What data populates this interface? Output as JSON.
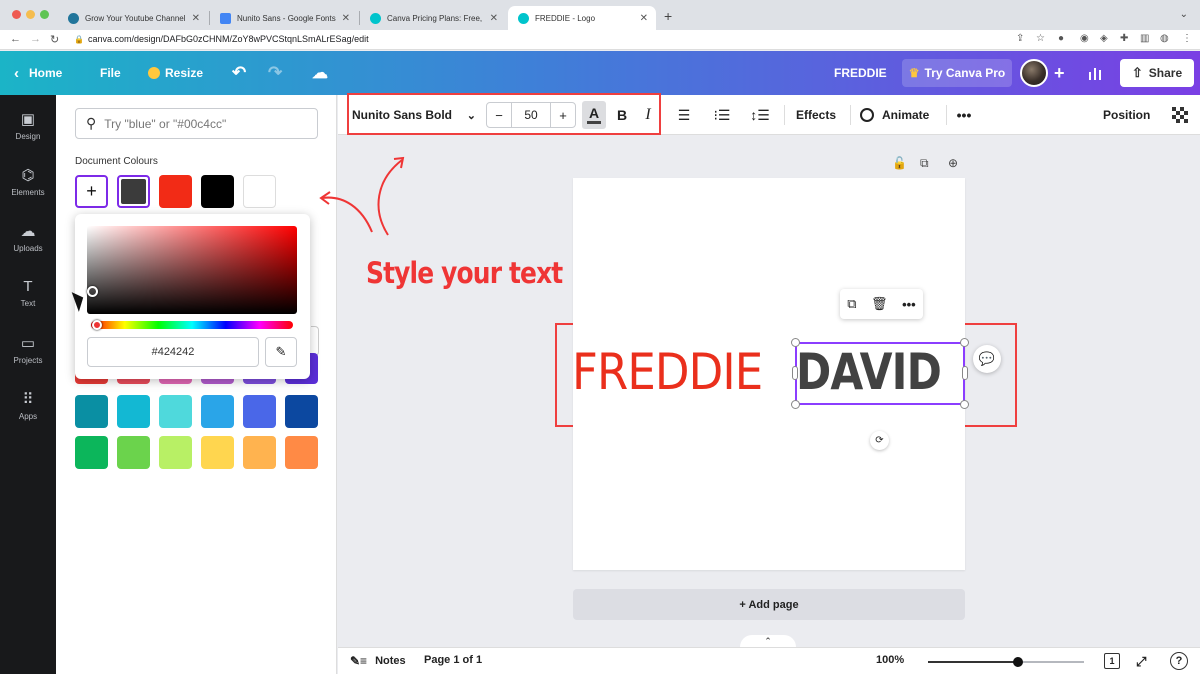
{
  "browser": {
    "tabs": [
      {
        "title": "Grow Your Youtube Channel F",
        "favicon_color": "#21759b"
      },
      {
        "title": "Nunito Sans - Google Fonts",
        "favicon_color": "#4285f4"
      },
      {
        "title": "Canva Pricing Plans: Free, Pro",
        "favicon_color": "#00c4cc"
      },
      {
        "title": "FREDDIE - Logo",
        "favicon_color": "#00c4cc"
      }
    ],
    "url": "canva.com/design/DAFbG0zCHNM/ZoY8wPVCStqnLSmALrESag/edit"
  },
  "header": {
    "home_label": "Home",
    "file_label": "File",
    "resize_label": "Resize",
    "doc_title": "FREDDIE",
    "pro_label": "Try Canva Pro",
    "share_label": "Share"
  },
  "rail": {
    "items": [
      {
        "label": "Design",
        "icon": "design-icon",
        "glyph": "▣"
      },
      {
        "label": "Elements",
        "icon": "elements-icon",
        "glyph": "⌬"
      },
      {
        "label": "Uploads",
        "icon": "uploads-icon",
        "glyph": "☁"
      },
      {
        "label": "Text",
        "icon": "text-icon",
        "glyph": "T"
      },
      {
        "label": "Projects",
        "icon": "projects-icon",
        "glyph": "▭"
      },
      {
        "label": "Apps",
        "icon": "apps-icon",
        "glyph": "⠿"
      }
    ]
  },
  "panel": {
    "search_placeholder": "Try \"blue\" or \"#00c4cc\"",
    "doc_colours_title": "Document Colours",
    "doc_colours": [
      "#3b3b3b",
      "#f22b16",
      "#000000",
      "#ffffff"
    ],
    "picker_hex": "#424242",
    "palette_rows": [
      [
        "#e53935",
        "#e84b5a",
        "#e066b3",
        "#b05acb",
        "#7c4ddc",
        "#5b2ed8"
      ],
      [
        "#0a8fa3",
        "#13b8d3",
        "#4fd9dc",
        "#2aa5e8",
        "#4a67e8",
        "#0c48a0"
      ],
      [
        "#0cb65b",
        "#6bd34c",
        "#b8f065",
        "#ffd64f",
        "#ffb34f",
        "#ff8a45"
      ]
    ]
  },
  "toolbar": {
    "font_name": "Nunito Sans Bold",
    "font_size": "50",
    "minus": "−",
    "plus": "+",
    "color_letter": "A",
    "bold": "B",
    "italic": "I",
    "effects_label": "Effects",
    "animate_label": "Animate",
    "position_label": "Position"
  },
  "annotation": {
    "text": "Style your text",
    "color": "#ef3535"
  },
  "canvas": {
    "word_left": "FREDDIE",
    "word_right": "DAVID",
    "word_left_color": "#ea2f1c",
    "word_right_color": "#424242",
    "add_page_label": "+ Add page"
  },
  "bottom": {
    "notes_label": "Notes",
    "page_label": "Page 1 of 1",
    "zoom_label": "100%",
    "zoom_level": 0.58,
    "page_count": "1"
  }
}
